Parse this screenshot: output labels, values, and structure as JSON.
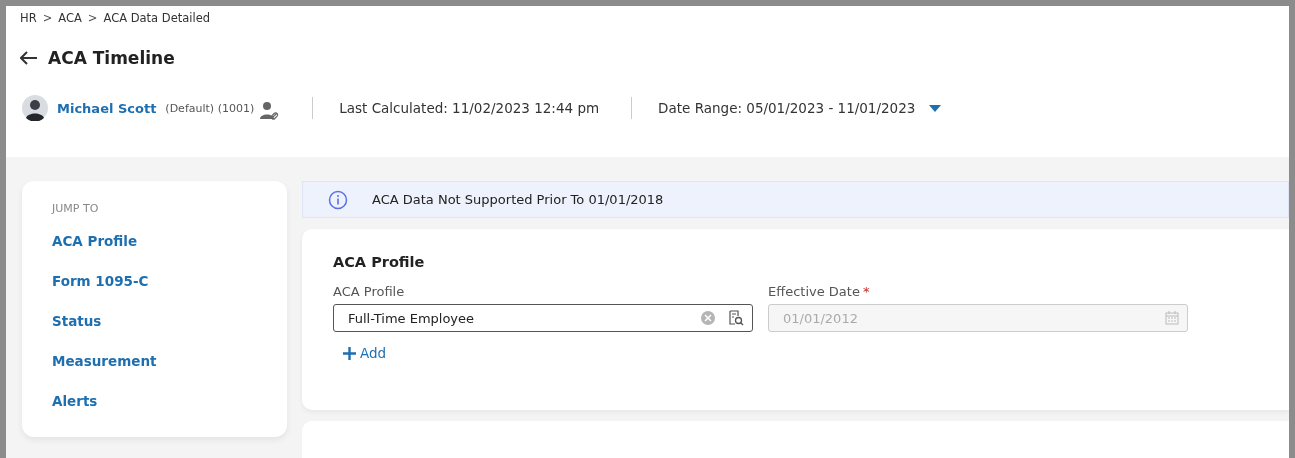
{
  "breadcrumb": [
    "HR",
    "ACA",
    "ACA Data Detailed"
  ],
  "breadcrumb_separator": ">",
  "title": "ACA Timeline",
  "employee": {
    "name": "Michael Scott",
    "detail": "(Default) (1001)"
  },
  "last_calculated": "Last Calculated: 11/02/2023 12:44 pm",
  "date_range": "Date Range: 05/01/2023 - 11/01/2023",
  "jump_to": {
    "heading": "JUMP TO",
    "items": [
      "ACA Profile",
      "Form 1095-C",
      "Status",
      "Measurement",
      "Alerts"
    ]
  },
  "notice": "ACA Data Not Supported Prior To 01/01/2018",
  "profile_card": {
    "title": "ACA Profile",
    "fields": [
      {
        "label": "ACA Profile",
        "value": "Full-Time Employee",
        "required": false,
        "disabled": false,
        "kind": "lookup"
      },
      {
        "label": "Effective Date",
        "value": "01/01/2012",
        "required": true,
        "disabled": true,
        "kind": "date"
      }
    ],
    "required_mark": "*",
    "add_button": "Add"
  }
}
